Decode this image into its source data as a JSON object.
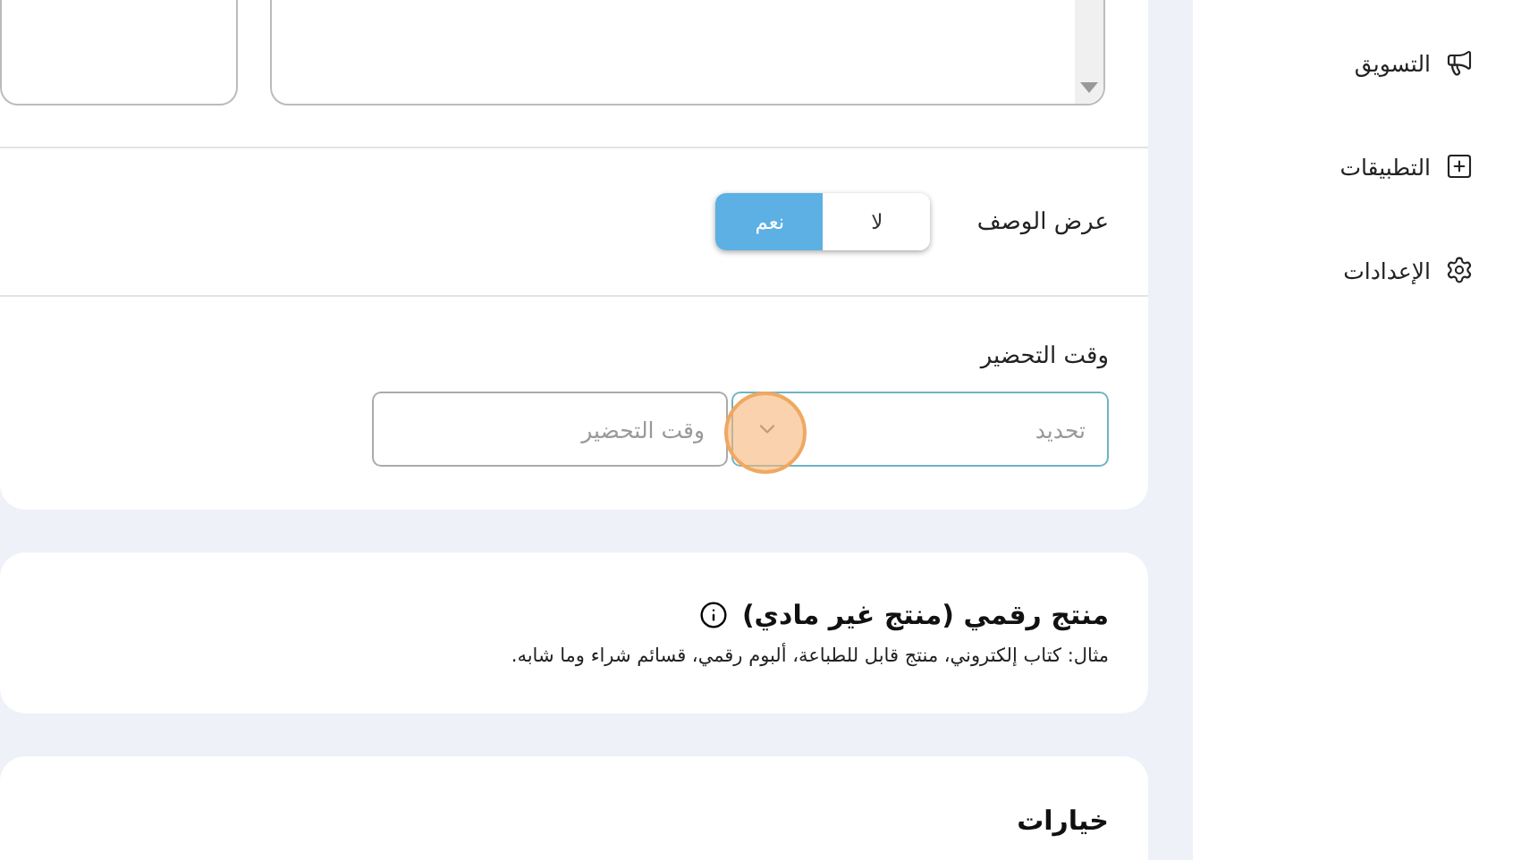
{
  "sidebar": {
    "items": [
      {
        "label": "التسويق",
        "kind": "megaphone"
      },
      {
        "label": "التطبيقات",
        "kind": "apps"
      },
      {
        "label": "الإعدادات",
        "kind": "settings"
      }
    ]
  },
  "description_toggle": {
    "label": "عرض الوصف",
    "options": [
      {
        "label": "لا",
        "selected": false
      },
      {
        "label": "نعم",
        "selected": true
      }
    ]
  },
  "prep_time": {
    "label": "وقت التحضير",
    "select": {
      "placeholder": "تحديد"
    },
    "input": {
      "placeholder": "وقت التحضير"
    }
  },
  "digital_product": {
    "title": "منتج رقمي (منتج غير مادي)",
    "description": "مثال: كتاب إلكتروني، منتج قابل للطباعة، ألبوم رقمي، قسائم شراء وما شابه."
  },
  "options": {
    "title": "خيارات"
  }
}
